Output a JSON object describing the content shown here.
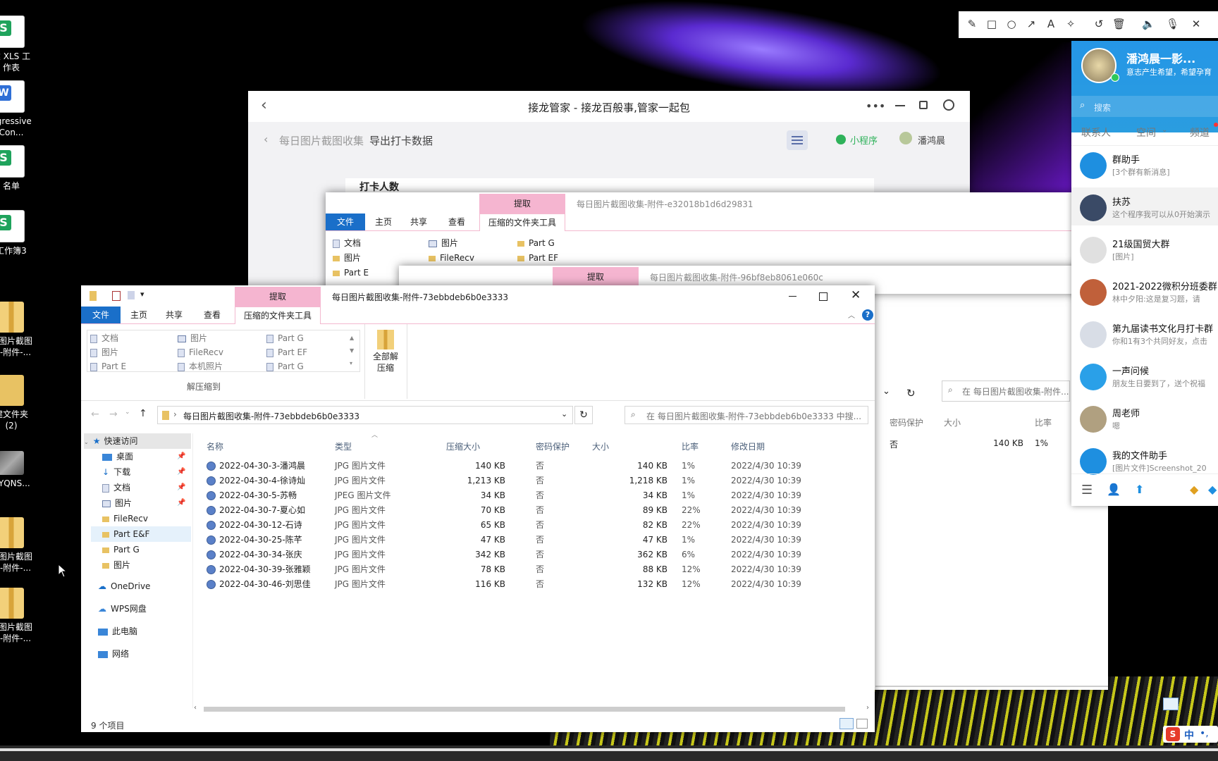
{
  "desktop": {
    "icons": [
      {
        "label": "建 XLS 工\n作表",
        "type": "sheet"
      },
      {
        "label": "ggressive\nCon...",
        "type": "word"
      },
      {
        "label": "名单",
        "type": "sheet"
      },
      {
        "label": "工作簿3",
        "type": "sheet"
      },
      {
        "label": "日图片截图\n集-附件-...",
        "type": "zip"
      },
      {
        "label": "建文件夹\n(2)",
        "type": "folder"
      },
      {
        "label": "DYQNS...",
        "type": "photo"
      },
      {
        "label": "日图片截图\n集-附件-...",
        "type": "zip"
      },
      {
        "label": "日图片截图\n集-附件-...",
        "type": "zip"
      }
    ]
  },
  "jielong": {
    "title": "接龙管家 - 接龙百般事,管家一起包",
    "back": "‹",
    "breadcrumb_parent": "每日图片截图收集",
    "breadcrumb_current": "导出打卡数据",
    "mini_program": "小程序",
    "user": "潘鸿晨",
    "partial_heading": "打卡人数"
  },
  "explorer_back1": {
    "title": "每日图片截图收集-附件-e32018b1d6d29831",
    "extract_tab": "提取",
    "tabs": [
      "文件",
      "主页",
      "共享",
      "查看",
      "压缩的文件夹工具"
    ],
    "ribbon_items": [
      "文档",
      "图片",
      "FileRecv",
      "Part G",
      "图片",
      "Part EF",
      "Part E"
    ],
    "status_row": {
      "protect": "否",
      "size": "140 KB",
      "ratio": "1%"
    },
    "headers": {
      "protect": "密码保护",
      "size": "大小",
      "ratio": "比率"
    },
    "search": "在 每日图片截图收集-附件..."
  },
  "explorer_back2": {
    "title": "每日图片截图收集-附件-96bf8eb8061e060c",
    "extract_tab": "提取"
  },
  "explorer": {
    "title": "每日图片截图收集-附件-73ebbdeb6b0e3333",
    "extract_tab": "提取",
    "tabs": [
      "文件",
      "主页",
      "共享",
      "查看",
      "压缩的文件夹工具"
    ],
    "ribbon": {
      "col1": [
        "文档",
        "图片",
        "Part E"
      ],
      "col2": [
        "图片",
        "FileRecv",
        "本机照片"
      ],
      "col3": [
        "Part G",
        "Part EF",
        "Part G"
      ],
      "group_label": "解压缩到",
      "extract_all": "全部解\n压缩"
    },
    "address": "每日图片截图收集-附件-73ebbdeb6b0e3333",
    "search_placeholder": "在 每日图片截图收集-附件-73ebbdeb6b0e3333 中搜...",
    "nav": {
      "quick_access": "快速访问",
      "items": [
        "桌面",
        "下载",
        "文档",
        "图片",
        "FileRecv",
        "Part E&F",
        "Part G",
        "图片"
      ],
      "onedrive": "OneDrive",
      "wps": "WPS网盘",
      "pc": "此电脑",
      "network": "网络"
    },
    "columns": [
      "名称",
      "类型",
      "压缩大小",
      "密码保护",
      "大小",
      "比率",
      "修改日期"
    ],
    "rows": [
      [
        "2022-04-30-3-潘鸿晨",
        "JPG 图片文件",
        "140 KB",
        "否",
        "140 KB",
        "1%",
        "2022/4/30 10:39"
      ],
      [
        "2022-04-30-4-徐诗灿",
        "JPG 图片文件",
        "1,213 KB",
        "否",
        "1,218 KB",
        "1%",
        "2022/4/30 10:39"
      ],
      [
        "2022-04-30-5-苏畅",
        "JPEG 图片文件",
        "34 KB",
        "否",
        "34 KB",
        "1%",
        "2022/4/30 10:39"
      ],
      [
        "2022-04-30-7-夏心如",
        "JPG 图片文件",
        "70 KB",
        "否",
        "89 KB",
        "22%",
        "2022/4/30 10:39"
      ],
      [
        "2022-04-30-12-石诗",
        "JPG 图片文件",
        "65 KB",
        "否",
        "82 KB",
        "22%",
        "2022/4/30 10:39"
      ],
      [
        "2022-04-30-25-陈芊",
        "JPG 图片文件",
        "47 KB",
        "否",
        "47 KB",
        "1%",
        "2022/4/30 10:39"
      ],
      [
        "2022-04-30-34-张庆",
        "JPG 图片文件",
        "342 KB",
        "否",
        "362 KB",
        "6%",
        "2022/4/30 10:39"
      ],
      [
        "2022-04-30-39-张雅颖",
        "JPG 图片文件",
        "78 KB",
        "否",
        "88 KB",
        "12%",
        "2022/4/30 10:39"
      ],
      [
        "2022-04-30-46-刘思佳",
        "JPG 图片文件",
        "116 KB",
        "否",
        "132 KB",
        "12%",
        "2022/4/30 10:39"
      ]
    ],
    "status": "9 个项目"
  },
  "qq": {
    "name": "潘鸿晨一影...",
    "signature": "意志产生希望，希望孕育",
    "search": "搜索",
    "tabs": [
      "联系人",
      "空间",
      "频道"
    ],
    "chats": [
      {
        "name": "群助手",
        "sub": "[3个群有新消息]",
        "color": "#1e8fe0"
      },
      {
        "name": "扶苏",
        "sub": "这个程序我可以从0开始演示",
        "color": "#3a4a66"
      },
      {
        "name": "21级国贸大群",
        "sub": "[图片]",
        "color": "#e0e0e0"
      },
      {
        "name": "2021-2022微积分班委群",
        "sub": "林中夕阳:这是复习题，请",
        "color": "#c0603a"
      },
      {
        "name": "第九届读书文化月打卡群",
        "sub": "你和1有3个共同好友，点击",
        "color": "#d8dde6"
      },
      {
        "name": "一声问候",
        "sub": "朋友生日要到了，送个祝福",
        "color": "#2aa0e8"
      },
      {
        "name": "周老师",
        "sub": "嗯",
        "color": "#b0a080"
      },
      {
        "name": "我的文件助手",
        "sub": "[图片文件]Screenshot_20",
        "color": "#1e8fe0"
      }
    ]
  },
  "ime": {
    "label": "中"
  },
  "colors": {
    "accent": "#0078d7",
    "extract_tab": "#f5b5d0",
    "qq_blue": "#1e8fe0"
  }
}
